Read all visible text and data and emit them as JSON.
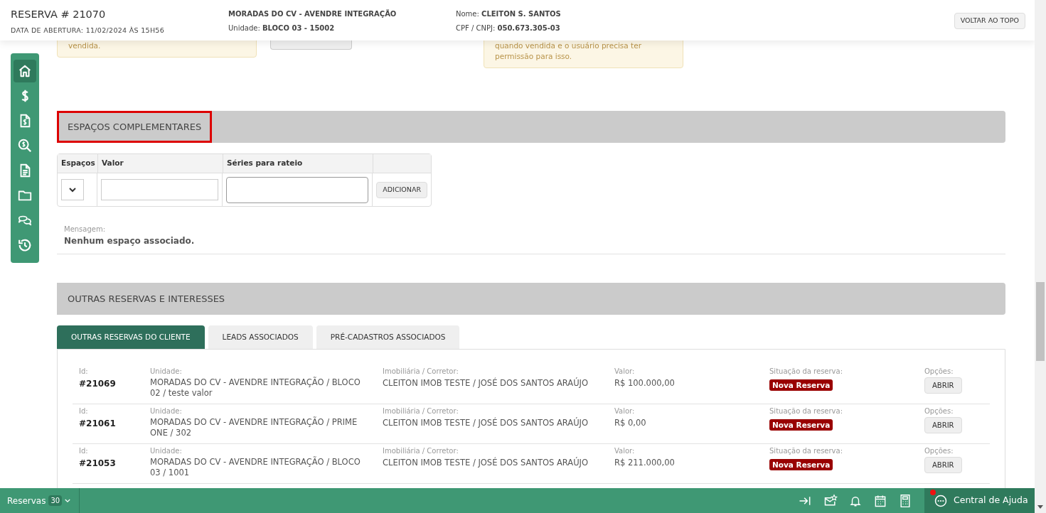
{
  "header": {
    "title": "RESERVA # 21070",
    "opened": "DATA DE ABERTURA: 11/02/2024 ÀS 15H56",
    "project": "MORADAS DO CV - AVENDRE INTEGRAÇÃO",
    "unit_label": "Unidade:",
    "unit": "BLOCO 03 - 15002",
    "name_label": "Nome:",
    "name": "CLEITON S. SANTOS",
    "doc_label": "CPF / CNPJ:",
    "doc": "050.673.305-03",
    "top_button": "VOLTAR AO TOPO"
  },
  "sidebar": {
    "items": [
      {
        "selected": true
      },
      {
        "selected": false
      },
      {
        "selected": false
      },
      {
        "selected": false
      },
      {
        "selected": false
      },
      {
        "selected": false
      },
      {
        "selected": false
      },
      {
        "selected": false
      }
    ]
  },
  "notes": {
    "left": "vendida.",
    "right": "quando vendida e o usuário precisa ter permissão para isso."
  },
  "spaces": {
    "title": "ESPAÇOS COMPLEMENTARES",
    "highlighted": true,
    "columns": [
      "Espaços",
      "Valor",
      "Séries para rateio"
    ],
    "add_button": "ADICIONAR",
    "message_label": "Mensagem:",
    "message": "Nenhum espaço associado."
  },
  "others": {
    "title": "OUTRAS RESERVAS E INTERESSES",
    "tabs": [
      {
        "label": "OUTRAS RESERVAS DO CLIENTE",
        "selected": true
      },
      {
        "label": "LEADS ASSOCIADOS",
        "selected": false
      },
      {
        "label": "PRÉ-CADASTROS ASSOCIADOS",
        "selected": false
      }
    ],
    "rows": [
      {
        "labels": {
          "id": "Id:",
          "unit": "Unidade:",
          "agent": "Imobiliária / Corretor:",
          "value": "Valor:",
          "status": "Situação da reserva:",
          "options": "Opções:"
        },
        "id": "#21069",
        "unit": "MORADAS DO CV - AVENDRE INTEGRAÇÃO / BLOCO 02 / teste valor",
        "agent": "CLEITON IMOB TESTE / JOSÉ DOS SANTOS ARAÚJO",
        "value": "R$ 100.000,00",
        "status": "Nova Reserva",
        "color": "#990000",
        "button": "ABRIR"
      },
      {
        "labels": {
          "id": "Id:",
          "unit": "Unidade:",
          "agent": "Imobiliária / Corretor:",
          "value": "Valor:",
          "status": "Situação da reserva:",
          "options": "Opções:"
        },
        "id": "#21061",
        "unit": "MORADAS DO CV - AVENDRE INTEGRAÇÃO / PRIME ONE / 302",
        "agent": "CLEITON IMOB TESTE / JOSÉ DOS SANTOS ARAÚJO",
        "value": "R$ 0,00",
        "status": "Nova Reserva",
        "color": "#990000",
        "button": "ABRIR"
      },
      {
        "labels": {
          "id": "Id:",
          "unit": "Unidade:",
          "agent": "Imobiliária / Corretor:",
          "value": "Valor:",
          "status": "Situação da reserva:",
          "options": "Opções:"
        },
        "id": "#21053",
        "unit": "MORADAS DO CV - AVENDRE INTEGRAÇÃO / BLOCO 03 / 1001",
        "agent": "CLEITON IMOB TESTE / JOSÉ DOS SANTOS ARAÚJO",
        "value": "R$ 211.000,00",
        "status": "Nova Reserva",
        "color": "#990000",
        "button": "ABRIR"
      }
    ]
  },
  "bottom_bar": {
    "label": "Reservas",
    "count": "30",
    "help": "Central de Ajuda",
    "help_notification": true
  }
}
